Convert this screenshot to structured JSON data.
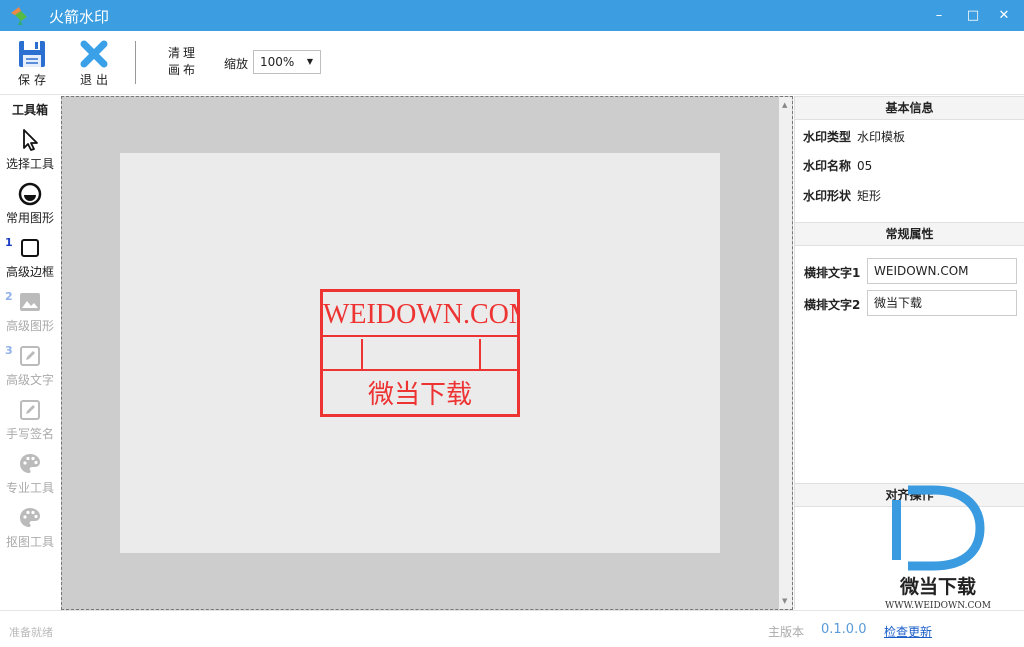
{
  "window": {
    "title": "火箭水印",
    "accent": "#3c9ee0"
  },
  "toolbar": {
    "save_label": "保存",
    "exit_label": "退出",
    "clear_canvas_line1": "清理",
    "clear_canvas_line2": "画布",
    "zoom_label": "缩放",
    "zoom_value": "100%"
  },
  "toolbox": {
    "title": "工具箱",
    "tools": [
      {
        "label": "选择工具",
        "icon": "cursor-icon",
        "enabled": true
      },
      {
        "label": "常用图形",
        "icon": "shape-icon",
        "enabled": true
      },
      {
        "label": "高级边框",
        "icon": "border-icon",
        "enabled": true,
        "badge": "1"
      },
      {
        "label": "高级图形",
        "icon": "image-icon",
        "enabled": false,
        "badge": "2"
      },
      {
        "label": "高级文字",
        "icon": "edit-text-icon",
        "enabled": false,
        "badge": "3"
      },
      {
        "label": "手写签名",
        "icon": "signature-icon",
        "enabled": false
      },
      {
        "label": "专业工具",
        "icon": "palette-icon",
        "enabled": false
      },
      {
        "label": "抠图工具",
        "icon": "palette-icon",
        "enabled": false
      }
    ]
  },
  "canvas": {
    "stamp_text_top": "WEIDOWN.COM",
    "stamp_text_bottom": "微当下载",
    "stamp_color": "#e33333"
  },
  "panel": {
    "basic_info_title": "基本信息",
    "basic_info": [
      {
        "key": "水印类型",
        "value": "水印模板"
      },
      {
        "key": "水印名称",
        "value": "05"
      },
      {
        "key": "水印形状",
        "value": "矩形"
      }
    ],
    "general_props_title": "常规属性",
    "props": [
      {
        "label": "横排文字1",
        "value": "WEIDOWN.COM"
      },
      {
        "label": "横排文字2",
        "value": "微当下载"
      }
    ],
    "align_title": "对齐操作"
  },
  "watermark": {
    "brand": "微当下载",
    "url": "WWW.WEIDOWN.COM"
  },
  "status": {
    "text": "准备就绪",
    "version_label": "主版本",
    "version_value": "0.1.0.0",
    "update_link": "检查更新"
  }
}
